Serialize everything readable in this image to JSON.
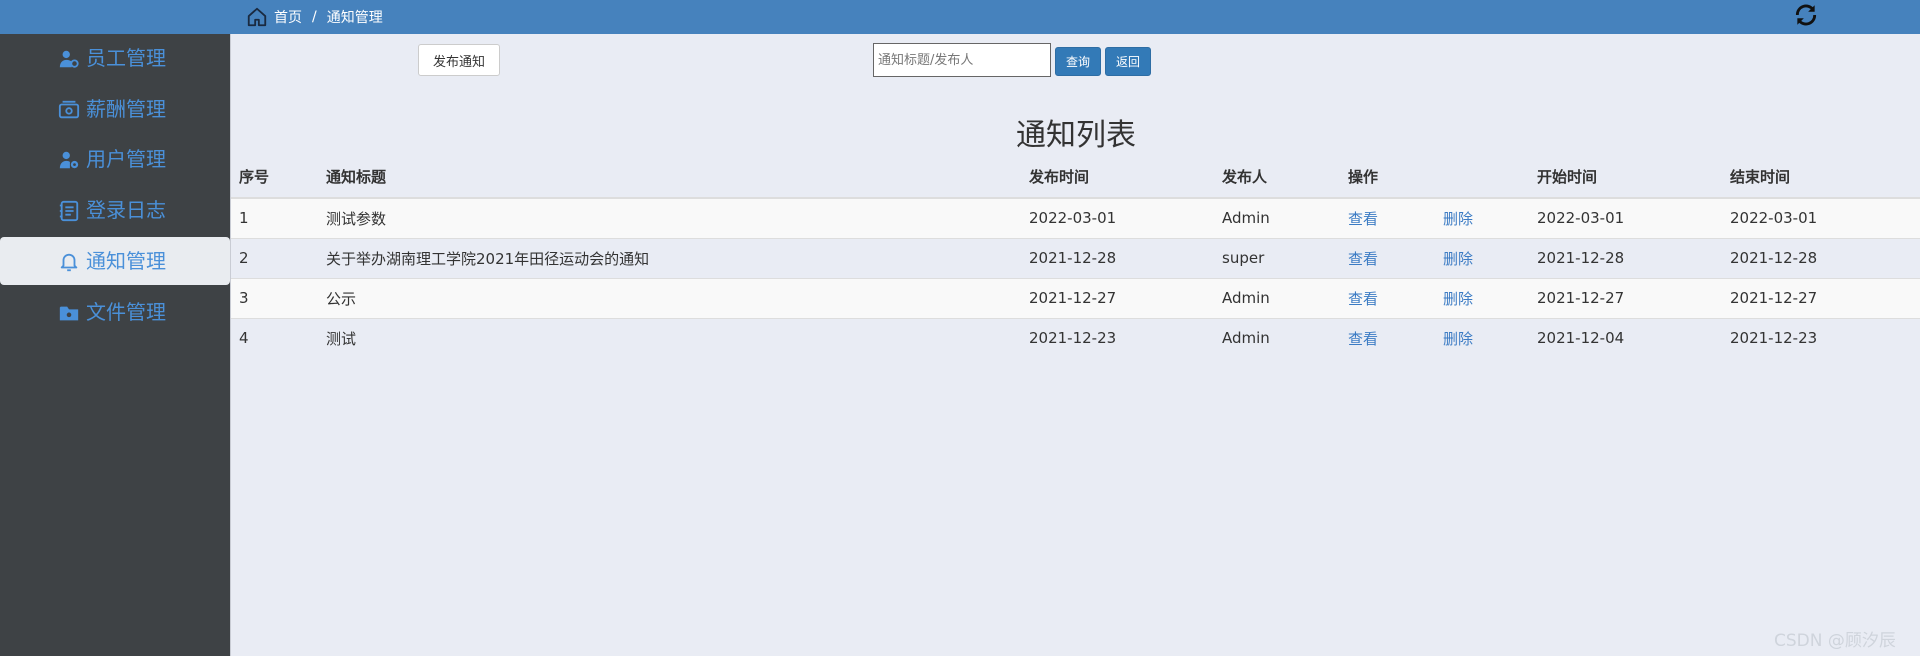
{
  "breadcrumb": {
    "home": "首页",
    "separator": "/",
    "current": "通知管理"
  },
  "refresh_icon": "refresh-icon",
  "sidebar": {
    "items": [
      {
        "label": "员工管理",
        "icon": "employee-icon",
        "active": false
      },
      {
        "label": "薪酬管理",
        "icon": "salary-icon",
        "active": false
      },
      {
        "label": "用户管理",
        "icon": "user-settings-icon",
        "active": false
      },
      {
        "label": "登录日志",
        "icon": "log-icon",
        "active": false
      },
      {
        "label": "通知管理",
        "icon": "bell-user-icon",
        "active": true
      },
      {
        "label": "文件管理",
        "icon": "folder-icon",
        "active": false
      }
    ]
  },
  "toolbar": {
    "publish_label": "发布通知",
    "search_placeholder": "通知标题/发布人",
    "search_value": "",
    "query_label": "查询",
    "back_label": "返回"
  },
  "list_title": "通知列表",
  "table": {
    "headers": {
      "no": "序号",
      "title": "通知标题",
      "publish_time": "发布时间",
      "author": "发布人",
      "action": "操作",
      "start_time": "开始时间",
      "end_time": "结束时间"
    },
    "view_label": "查看",
    "delete_label": "删除",
    "rows": [
      {
        "no": "1",
        "title": "测试参数",
        "publish_time": "2022-03-01",
        "author": "Admin",
        "start_time": "2022-03-01",
        "end_time": "2022-03-01"
      },
      {
        "no": "2",
        "title": "关于举办湖南理工学院2021年田径运动会的通知",
        "publish_time": "2021-12-28",
        "author": "super",
        "start_time": "2021-12-28",
        "end_time": "2021-12-28"
      },
      {
        "no": "3",
        "title": "公示",
        "publish_time": "2021-12-27",
        "author": "Admin",
        "start_time": "2021-12-27",
        "end_time": "2021-12-27"
      },
      {
        "no": "4",
        "title": "测试",
        "publish_time": "2021-12-23",
        "author": "Admin",
        "start_time": "2021-12-04",
        "end_time": "2021-12-23"
      }
    ]
  },
  "watermark": "CSDN @顾汐辰",
  "colors": {
    "topbar": "#4682bd",
    "sidebar": "#3e4245",
    "accent": "#4a90d9",
    "button": "#337ab7",
    "link": "#3b7bc4"
  }
}
